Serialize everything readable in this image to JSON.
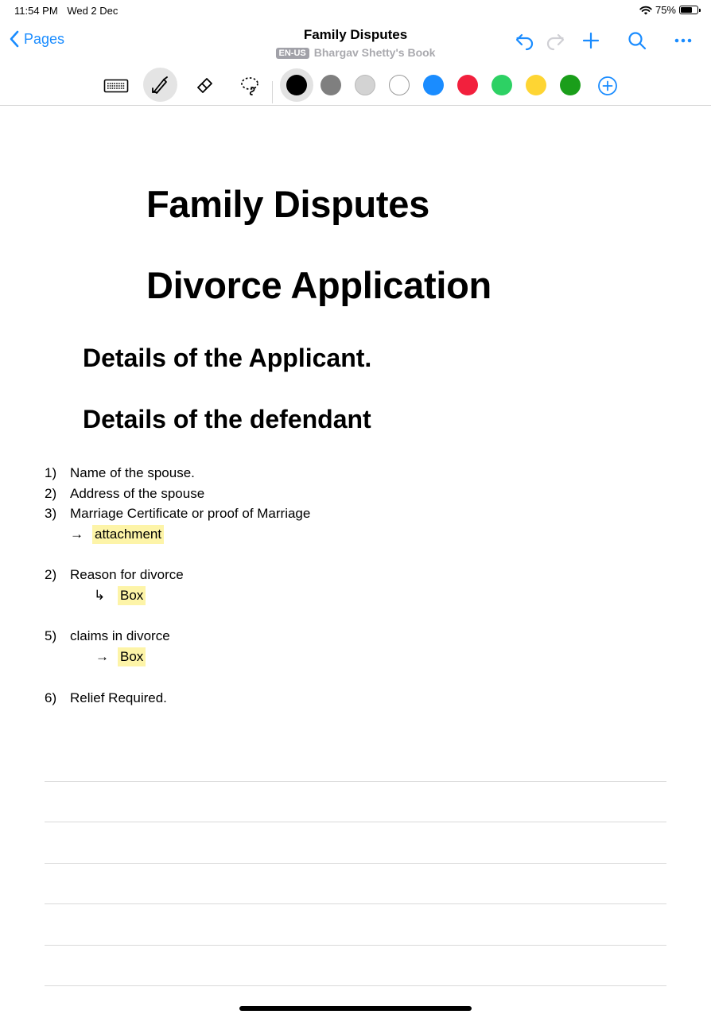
{
  "status_bar": {
    "time": "11:54 PM",
    "date": "Wed 2 Dec",
    "battery_percent": "75%",
    "battery_level": 0.75
  },
  "nav": {
    "back_label": "Pages",
    "title": "Family Disputes",
    "language_badge": "EN-US",
    "book_name": "Bhargav Shetty's Book",
    "accent_color": "#1a8cff"
  },
  "toolbar": {
    "tools": [
      "keyboard-icon",
      "pen-icon",
      "eraser-icon",
      "lasso-icon"
    ],
    "selected_tool": "pen-icon",
    "colors": [
      "#000000",
      "#7f7f7f",
      "#d3d3d3",
      "#ffffff",
      "#1a8cff",
      "#f2203d",
      "#2dd164",
      "#fed533",
      "#1a9e1a"
    ],
    "selected_color": "#000000"
  },
  "document": {
    "heading1": "Family Disputes",
    "heading2": "Divorce Application",
    "heading3": "Details of the Applicant.",
    "heading4": "Details of the defendant",
    "items": [
      {
        "num": "1)",
        "text": "Name of the spouse."
      },
      {
        "num": "2)",
        "text": "Address of the spouse"
      },
      {
        "num": "3)",
        "text": "Marriage Certificate or proof of Marriage"
      },
      {
        "arrow": "→",
        "text": "attachment"
      },
      {
        "num": "2)",
        "text": "Reason for divorce"
      },
      {
        "arrow": "↳",
        "text": "Box"
      },
      {
        "num": "5)",
        "text": "claims in divorce"
      },
      {
        "arrow": "→",
        "text": "Box"
      },
      {
        "num": "6)",
        "text": "Relief Required."
      }
    ]
  }
}
